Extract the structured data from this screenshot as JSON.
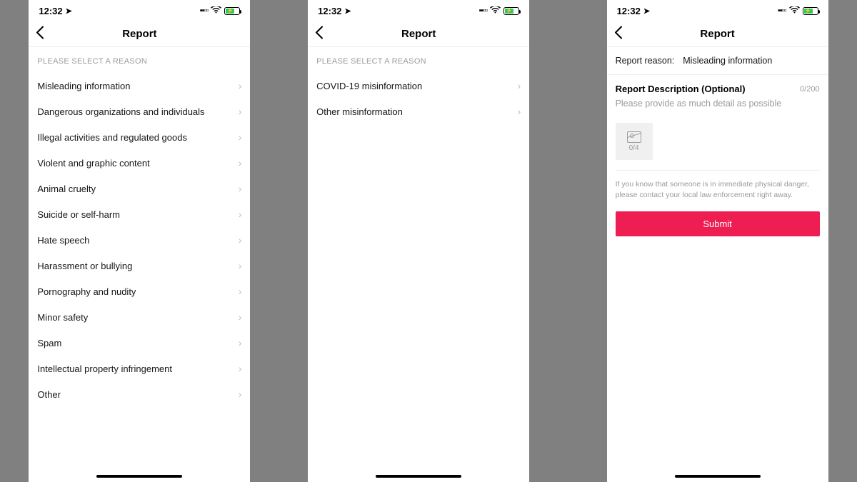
{
  "status": {
    "time": "12:32",
    "loc_glyph": "➤"
  },
  "screen1": {
    "title": "Report",
    "section": "PLEASE SELECT A REASON",
    "items": [
      "Misleading information",
      "Dangerous organizations and individuals",
      "Illegal activities and regulated goods",
      "Violent and graphic content",
      "Animal cruelty",
      "Suicide or self-harm",
      "Hate speech",
      "Harassment or bullying",
      "Pornography and nudity",
      "Minor safety",
      "Spam",
      "Intellectual property infringement",
      "Other"
    ]
  },
  "screen2": {
    "title": "Report",
    "section": "PLEASE SELECT A REASON",
    "items": [
      "COVID-19 misinformation",
      "Other misinformation"
    ]
  },
  "screen3": {
    "title": "Report",
    "reason_key": "Report reason:",
    "reason_val": "Misleading information",
    "desc_title": "Report Description (Optional)",
    "char_counter": "0/200",
    "placeholder": "Please provide as much detail as possible",
    "upload_counter": "0/4",
    "disclaimer": "If you know that someone is in immediate physical danger, please contact your local law enforcement right away.",
    "submit": "Submit"
  }
}
